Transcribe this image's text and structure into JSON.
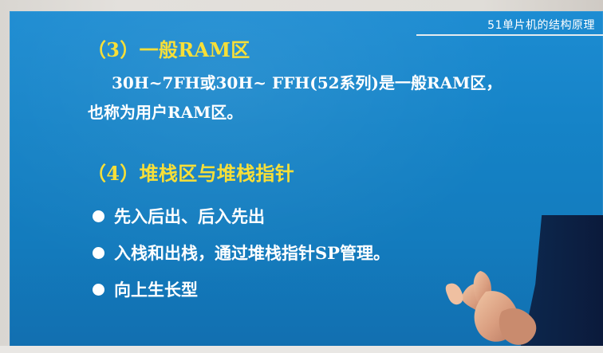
{
  "slide": {
    "top_label": "51单片机的结构原理",
    "section_3_title": "（3）一般RAM区",
    "section_3_line_1": "30H~7FH或30H~ FFH(52系列)是一般RAM区，",
    "section_3_line_2": "也称为用户RAM区。",
    "section_4_title": "（4）堆栈区与堆栈指针",
    "bullets": [
      "先入后出、后入先出",
      "入栈和出栈，通过堆栈指针SP管理。",
      "向上生长型"
    ]
  },
  "colors": {
    "slide_bg": "#1583c7",
    "heading": "#f7df38",
    "text": "#ffffff"
  }
}
